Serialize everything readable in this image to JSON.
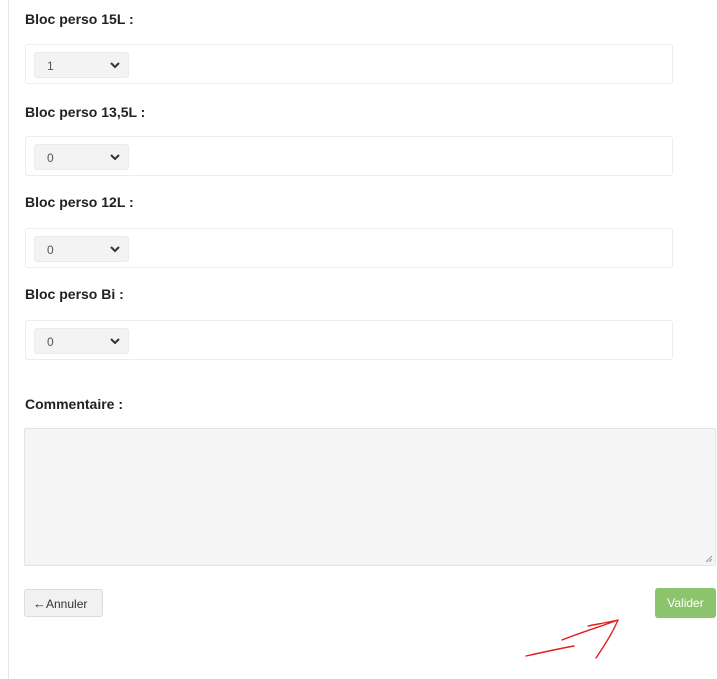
{
  "fields": [
    {
      "label": "Bloc perso 15L :",
      "value": "1"
    },
    {
      "label": "Bloc perso 13,5L :",
      "value": "0"
    },
    {
      "label": "Bloc perso 12L :",
      "value": "0"
    },
    {
      "label": "Bloc perso Bi :",
      "value": "0"
    }
  ],
  "comment": {
    "label": "Commentaire :",
    "value": ""
  },
  "buttons": {
    "cancel": "Annuler",
    "validate": "Valider"
  },
  "colors": {
    "validate_bg": "#8bc46c",
    "annotation": "#e02020"
  }
}
